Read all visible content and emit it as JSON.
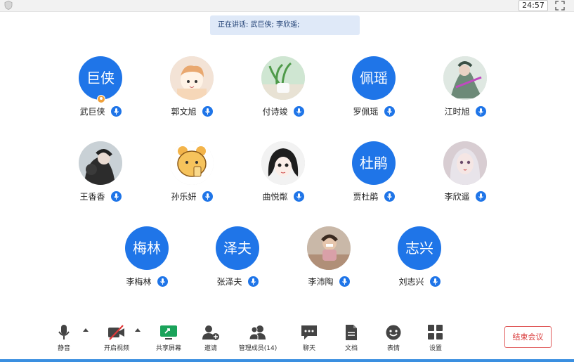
{
  "window": {
    "timer": "24:57"
  },
  "speaking_banner": {
    "label": "正在讲话:",
    "names": " 武巨侠; 李欣遥;"
  },
  "participants": [
    {
      "name": "武巨侠",
      "avatar_text": "巨侠",
      "is_host": true
    },
    {
      "name": "郭文旭",
      "avatar_text": ""
    },
    {
      "name": "付诗竣",
      "avatar_text": ""
    },
    {
      "name": "罗佩瑶",
      "avatar_text": "佩瑶"
    },
    {
      "name": "江时旭",
      "avatar_text": ""
    },
    {
      "name": "王香香",
      "avatar_text": ""
    },
    {
      "name": "孙乐妍",
      "avatar_text": ""
    },
    {
      "name": "曲悦粼",
      "avatar_text": ""
    },
    {
      "name": "贾杜鹃",
      "avatar_text": "杜鹃"
    },
    {
      "name": "李欣遥",
      "avatar_text": ""
    },
    {
      "name": "李梅林",
      "avatar_text": "梅林"
    },
    {
      "name": "张泽夫",
      "avatar_text": "泽夫"
    },
    {
      "name": "李沛陶",
      "avatar_text": ""
    },
    {
      "name": "刘志兴",
      "avatar_text": "志兴"
    }
  ],
  "toolbar": {
    "mute": "静音",
    "video": "开启视频",
    "share": "共享屏幕",
    "invite": "邀请",
    "members": "管理成员(14)",
    "chat": "聊天",
    "docs": "文档",
    "reactions": "表情",
    "settings": "设置",
    "end_meeting": "结束会议"
  },
  "colors": {
    "accent": "#1f75e8",
    "banner_bg": "#dfe9f8",
    "end_red": "#e05a5a",
    "share_green": "#1aa35a"
  }
}
